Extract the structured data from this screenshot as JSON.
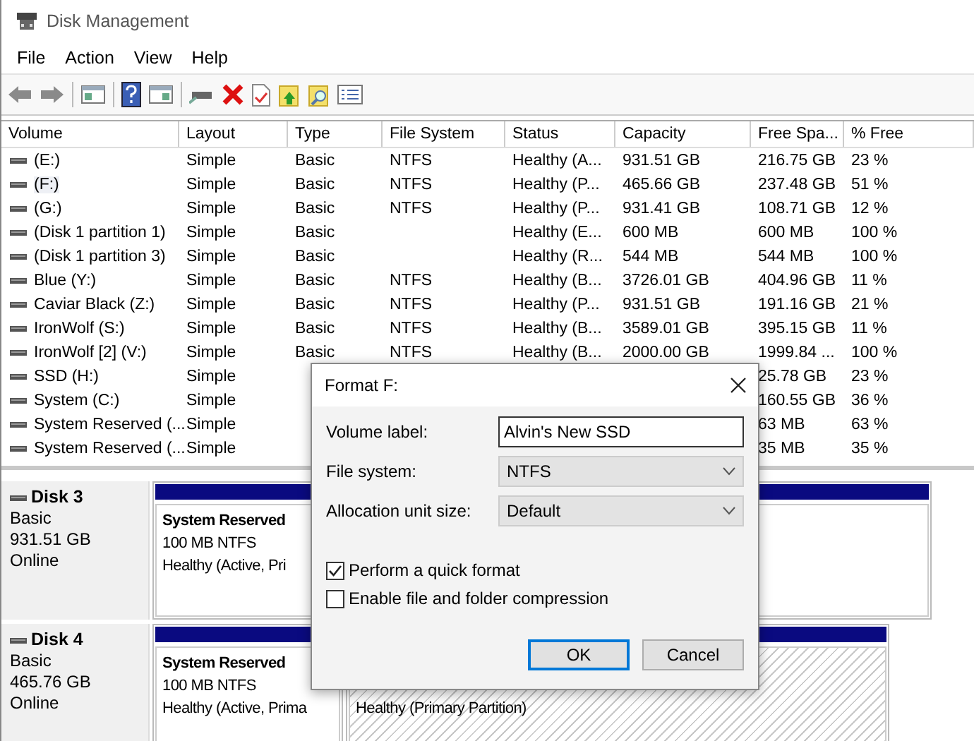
{
  "window": {
    "title": "Disk Management"
  },
  "menu": [
    "File",
    "Action",
    "View",
    "Help"
  ],
  "table": {
    "columns": [
      "Volume",
      "Layout",
      "Type",
      "File System",
      "Status",
      "Capacity",
      "Free Spa...",
      "% Free"
    ],
    "rows": [
      {
        "volume": "(E:)",
        "layout": "Simple",
        "type": "Basic",
        "file_system": "NTFS",
        "status": "Healthy (A...",
        "capacity": "931.51 GB",
        "free_space": "216.75 GB",
        "percent_free": "23 %",
        "selected": false
      },
      {
        "volume": "(F:)",
        "layout": "Simple",
        "type": "Basic",
        "file_system": "NTFS",
        "status": "Healthy (P...",
        "capacity": "465.66 GB",
        "free_space": "237.48 GB",
        "percent_free": "51 %",
        "selected": true
      },
      {
        "volume": "(G:)",
        "layout": "Simple",
        "type": "Basic",
        "file_system": "NTFS",
        "status": "Healthy (P...",
        "capacity": "931.41 GB",
        "free_space": "108.71 GB",
        "percent_free": "12 %",
        "selected": false
      },
      {
        "volume": "(Disk 1 partition 1)",
        "layout": "Simple",
        "type": "Basic",
        "status": "Healthy (E...",
        "capacity": "600 MB",
        "free_space": "600 MB",
        "percent_free": "100 %",
        "selected": false
      },
      {
        "volume": "(Disk 1 partition 3)",
        "layout": "Simple",
        "type": "Basic",
        "status": "Healthy (R...",
        "capacity": "544 MB",
        "free_space": "544 MB",
        "percent_free": "100 %",
        "selected": false
      },
      {
        "volume": "Blue (Y:)",
        "layout": "Simple",
        "type": "Basic",
        "file_system": "NTFS",
        "status": "Healthy (B...",
        "capacity": "3726.01 GB",
        "free_space": "404.96 GB",
        "percent_free": "11 %",
        "selected": false
      },
      {
        "volume": "Caviar Black (Z:)",
        "layout": "Simple",
        "type": "Basic",
        "file_system": "NTFS",
        "status": "Healthy (P...",
        "capacity": "931.51 GB",
        "free_space": "191.16 GB",
        "percent_free": "21 %",
        "selected": false
      },
      {
        "volume": "IronWolf (S:)",
        "layout": "Simple",
        "type": "Basic",
        "file_system": "NTFS",
        "status": "Healthy (B...",
        "capacity": "3589.01 GB",
        "free_space": "395.15 GB",
        "percent_free": "11 %",
        "selected": false
      },
      {
        "volume": "IronWolf [2] (V:)",
        "layout": "Simple",
        "type": "Basic",
        "file_system": "NTFS",
        "status": "Healthy (B...",
        "capacity": "2000.00 GB",
        "free_space": "1999.84 ...",
        "percent_free": "100 %",
        "selected": false
      },
      {
        "volume": "SSD (H:)",
        "layout": "Simple",
        "free_space": "25.78 GB",
        "percent_free": "23 %",
        "selected": false
      },
      {
        "volume": "System (C:)",
        "layout": "Simple",
        "free_space": "160.55 GB",
        "percent_free": "36 %",
        "selected": false
      },
      {
        "volume": "System Reserved (...",
        "layout": "Simple",
        "free_space": "63 MB",
        "percent_free": "63 %",
        "selected": false
      },
      {
        "volume": "System Reserved (...",
        "layout": "Simple",
        "free_space": "35 MB",
        "percent_free": "35 %",
        "selected": false
      }
    ]
  },
  "disks": [
    {
      "name": "Disk 3",
      "type": "Basic",
      "size": "931.51 GB",
      "state": "Online",
      "partitions": [
        {
          "name": "System Reserved",
          "size": "100 MB NTFS",
          "status": "Healthy (Active, Pri",
          "selected": false
        },
        {
          "selected": false
        }
      ]
    },
    {
      "name": "Disk 4",
      "type": "Basic",
      "size": "465.76 GB",
      "state": "Online",
      "partitions": [
        {
          "name": "System Reserved",
          "size": "100 MB NTFS",
          "status": "Healthy (Active, Prima",
          "selected": false
        },
        {
          "status": "Healthy (Primary Partition)",
          "selected": true
        }
      ]
    }
  ],
  "dialog": {
    "title": "Format F:",
    "fields": [
      {
        "kind": "text",
        "label": "Volume label:",
        "value": "Alvin's New SSD"
      },
      {
        "kind": "select",
        "label": "File system:",
        "value": "NTFS"
      },
      {
        "kind": "select",
        "label": "Allocation unit size:",
        "value": "Default"
      }
    ],
    "options": [
      {
        "label": "Perform a quick format",
        "checked": true
      },
      {
        "label": "Enable file and folder compression",
        "checked": false
      }
    ],
    "buttons": [
      {
        "label": "OK",
        "default": true
      },
      {
        "label": "Cancel",
        "default": false
      }
    ]
  }
}
